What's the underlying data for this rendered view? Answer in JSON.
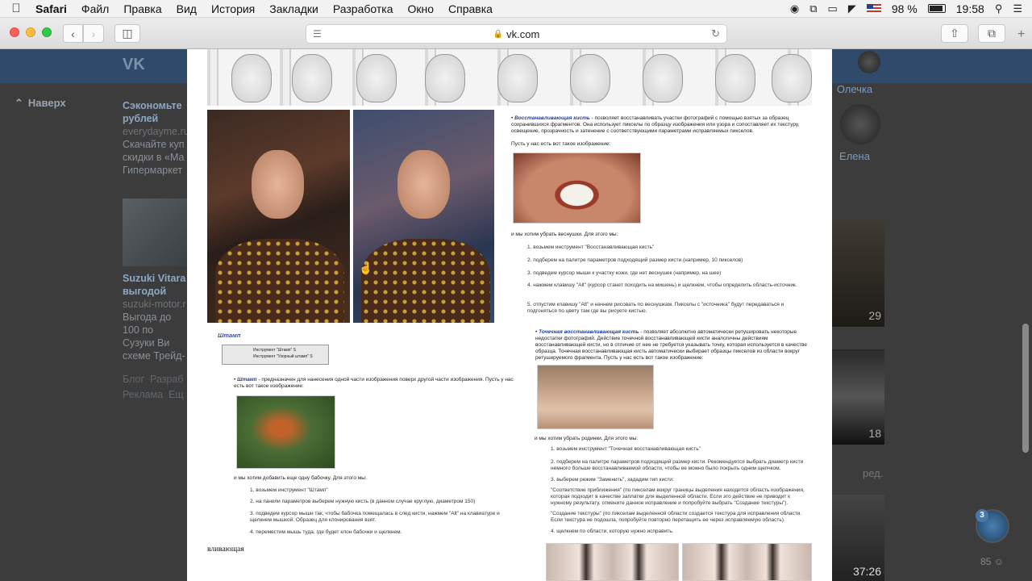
{
  "menubar": {
    "app": "Safari",
    "items": [
      "Файл",
      "Правка",
      "Вид",
      "История",
      "Закладки",
      "Разработка",
      "Окно",
      "Справка"
    ],
    "battery": "98 %",
    "time": "19:58"
  },
  "toolbar": {
    "url": "vk.com"
  },
  "vk": {
    "back_to_top": "Наверх",
    "friends": [
      {
        "name": "Олечка"
      },
      {
        "name": "Елена"
      }
    ],
    "ads": [
      {
        "title": "Сэкономьте рублей",
        "domain": "everydayme.ru",
        "text": "Скачайте куп скидки в «Ма Гипермаркет"
      },
      {
        "title": "Suzuki Vitara выгодой",
        "domain": "suzuki-motor.r",
        "text": "Выгода до 100 по Сузуки Ви схеме Трейд-"
      }
    ],
    "footer": [
      "Блог",
      "Разраб",
      "Реклама",
      "Ещ"
    ],
    "video_times": [
      "29",
      "18",
      "37:26"
    ],
    "right_label": "ред.",
    "chat_badge": "3",
    "viewers": "85"
  },
  "doc": {
    "restore_brush_title": "Восстанавливающая кисть",
    "restore_brush_desc": "- позволяет восстанавливать участки фотографий с помощью взятых за образец сохранившихся фрагментов. Она использует пикселы по образцу изображения или узора и сопоставляет их текстуру, освещение, прозрачность и затенение с соответствующими параметрами исправляемых пикселов.",
    "have_image": "Пусть у нас есть вот такое изображение:",
    "want_freckles": "и мы хотим убрать веснушки. Для этого мы:",
    "steps_1": [
      "1. возьмем инструмент \"Восстанавливающая кисть\"",
      "2. подберем на палитре параметров подходящий размер кисти (например, 10 пикселов)",
      "3. подведем курсор мыши к участку кожи, где нет веснушек (например, на шее)",
      "4. нажмем клавишу \"Alt\" (курсор станет походить на мишень) и щелкнем, чтобы определить область-источник.",
      "5. отпустим клавишу \"Alt\" и начнем рисовать по веснушкам. Пикселы с \"источника\" будут передаваться и подгоняться по цвету там где вы рисуете кистью."
    ],
    "stamp_header": "Штамп",
    "stamp_tool_1": "Инструмент \"Штамп\"",
    "stamp_tool_2": "Инструмент \"Узорный штамп\"",
    "stamp_key": "S",
    "stamp_title": "Штамп",
    "stamp_desc": "- предназначен для нанесения одной части изображения поверх другой части изображения. Пусть у нас есть вот такое изображение:",
    "want_butterfly": "и мы хотим добавить еще одну бабочку. Для этого мы:",
    "steps_2": [
      "1. возьмем инструмент \"Штамп\"",
      "2. на панели параметров выберем нужную кисть (в данном случае круглую, диаметром 150)",
      "3. подведем курсор мыши так, чтобы бабочка помещалась в след кисти, нажмем \"Alt\" на клавиатуре и щелкнем мышкой. Образец для клонирования взят.",
      "4. переместим мышь туда, где будет клон бабочки и щелкнем."
    ],
    "spot_title": "Точечная восстанавливающая кисть",
    "spot_desc": "- позволяет абсолютно автоматически ретушировать некоторые недостатки фотографий. Действие точечной восстанавливающей кисти аналогичны действиям восстанавливающей кисти, но в отличие от нее не требуется указывать точку, которая используется в качестве образца. Точечная восстанавливающая кисть автоматически выбирает образцы пикселов из области вокруг ретушируемого фрагмента. Пусть у нас есть вот такое изображение:",
    "want_moles": "и мы хотим убрать родинки. Для этого мы:",
    "steps_3": [
      "1. возьмем инструмент \"Точечная восстанавливающая кисть\"",
      "2. подберем на палитре параметров подходящий размер кисти. Рекомендуется выбрать диаметр кисти немного больше восстанавливаемой области, чтобы ее можно было покрыть одним щелчком.",
      "3. выберем режим \"Заменить\", зададим тип кисти:",
      "\"Соответствие приближения\" (по пикселам вокруг границы выделения находится область изображения, которая подходит в качестве заплатки для выделенной области. Если это действие не приводит к нужному результату, отмените данное исправление и попробуйте выбрать \"Создание текстуры\").",
      "\"Создание текстуры\" (по пикселам выделенной области создается текстура для исправления области. Если текстура не подошла, попробуйте повторно перетащить ее через исправляемую область).",
      "4. щелкнем по области, которую нужно исправить."
    ],
    "bottom_word": "вливающая"
  }
}
